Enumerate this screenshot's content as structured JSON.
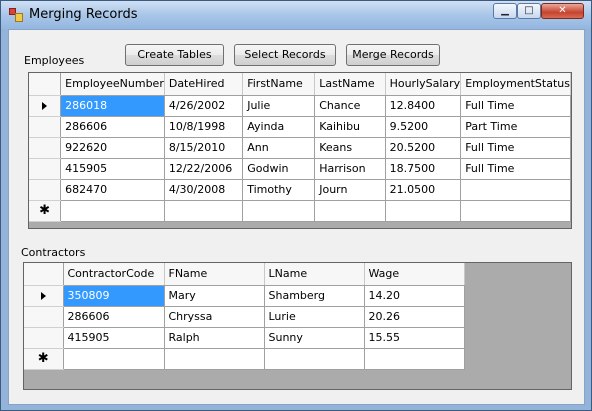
{
  "window": {
    "title": "Merging Records"
  },
  "toolbar": {
    "create_label": "Create Tables",
    "select_label": "Select Records",
    "merge_label": "Merge Records"
  },
  "employees": {
    "label": "Employees",
    "columns": [
      "EmployeeNumber",
      "DateHired",
      "FirstName",
      "LastName",
      "HourlySalary",
      "EmploymentStatus"
    ],
    "rows": [
      [
        "286018",
        "4/26/2002",
        "Julie",
        "Chance",
        "12.8400",
        "Full Time"
      ],
      [
        "286606",
        "10/8/1998",
        "Ayinda",
        "Kaihibu",
        "9.5200",
        "Part Time"
      ],
      [
        "922620",
        "8/15/2010",
        "Ann",
        "Keans",
        "20.5200",
        "Full Time"
      ],
      [
        "415905",
        "12/22/2006",
        "Godwin",
        "Harrison",
        "18.7500",
        "Full Time"
      ],
      [
        "682470",
        "4/30/2008",
        "Timothy",
        "Journ",
        "21.0500",
        ""
      ]
    ]
  },
  "contractors": {
    "label": "Contractors",
    "columns": [
      "ContractorCode",
      "FName",
      "LName",
      "Wage"
    ],
    "rows": [
      [
        "350809",
        "Mary",
        "Shamberg",
        "14.20"
      ],
      [
        "286606",
        "Chryssa",
        "Lurie",
        "20.26"
      ],
      [
        "415905",
        "Ralph",
        "Sunny",
        "15.55"
      ]
    ]
  },
  "row_markers": {
    "current": "arrow",
    "new": "✱"
  },
  "colors": {
    "selection": "#3399ff",
    "grid_background": "#ababab",
    "client": "#f0f0f0"
  }
}
